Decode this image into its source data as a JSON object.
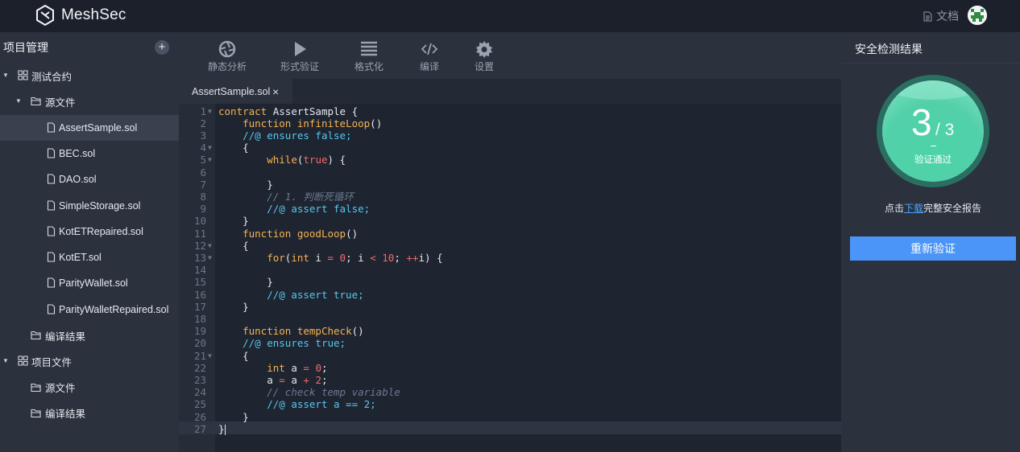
{
  "app": {
    "name": "MeshSec",
    "docs_label": "文档"
  },
  "sidebar": {
    "title": "项目管理",
    "add_icon": "+",
    "tree": [
      {
        "label": "测试合约",
        "icon": "grid-icon",
        "level": 0,
        "expanded": true
      },
      {
        "label": "源文件",
        "icon": "folder-icon",
        "level": 1,
        "expanded": true
      },
      {
        "label": "AssertSample.sol",
        "icon": "file-icon",
        "level": 2,
        "selected": true
      },
      {
        "label": "BEC.sol",
        "icon": "file-icon",
        "level": 2
      },
      {
        "label": "DAO.sol",
        "icon": "file-icon",
        "level": 2
      },
      {
        "label": "SimpleStorage.sol",
        "icon": "file-icon",
        "level": 2
      },
      {
        "label": "KotETRepaired.sol",
        "icon": "file-icon",
        "level": 2
      },
      {
        "label": "KotET.sol",
        "icon": "file-icon",
        "level": 2
      },
      {
        "label": "ParityWallet.sol",
        "icon": "file-icon",
        "level": 2
      },
      {
        "label": "ParityWalletRepaired.sol",
        "icon": "file-icon",
        "level": 2
      },
      {
        "label": "编译结果",
        "icon": "folder-icon",
        "level": 1
      },
      {
        "label": "项目文件",
        "icon": "grid-icon",
        "level": 0,
        "expanded": true
      },
      {
        "label": "源文件",
        "icon": "folder-icon",
        "level": 1
      },
      {
        "label": "编译结果",
        "icon": "folder-icon",
        "level": 1
      }
    ]
  },
  "toolbar": {
    "static_analysis": "静态分析",
    "formal_verification": "形式验证",
    "format": "格式化",
    "compile": "编译",
    "settings": "设置"
  },
  "editor": {
    "tab_label": "AssertSample.sol",
    "close_glyph": "×",
    "line_count": 27
  },
  "result_panel": {
    "title": "安全检测结果",
    "passed": "3",
    "total": "/ 3",
    "status": "验证通过",
    "report_prefix": "点击",
    "report_link": "下载",
    "report_suffix": "完整安全报告",
    "reverify_button": "重新验证"
  },
  "colors": {
    "accent": "#4a95f7",
    "gauge": "#52d0a9",
    "keyword": "#f6b352",
    "number": "#f26b6b",
    "spec": "#56c8f0",
    "comment": "#6b7a8f"
  }
}
